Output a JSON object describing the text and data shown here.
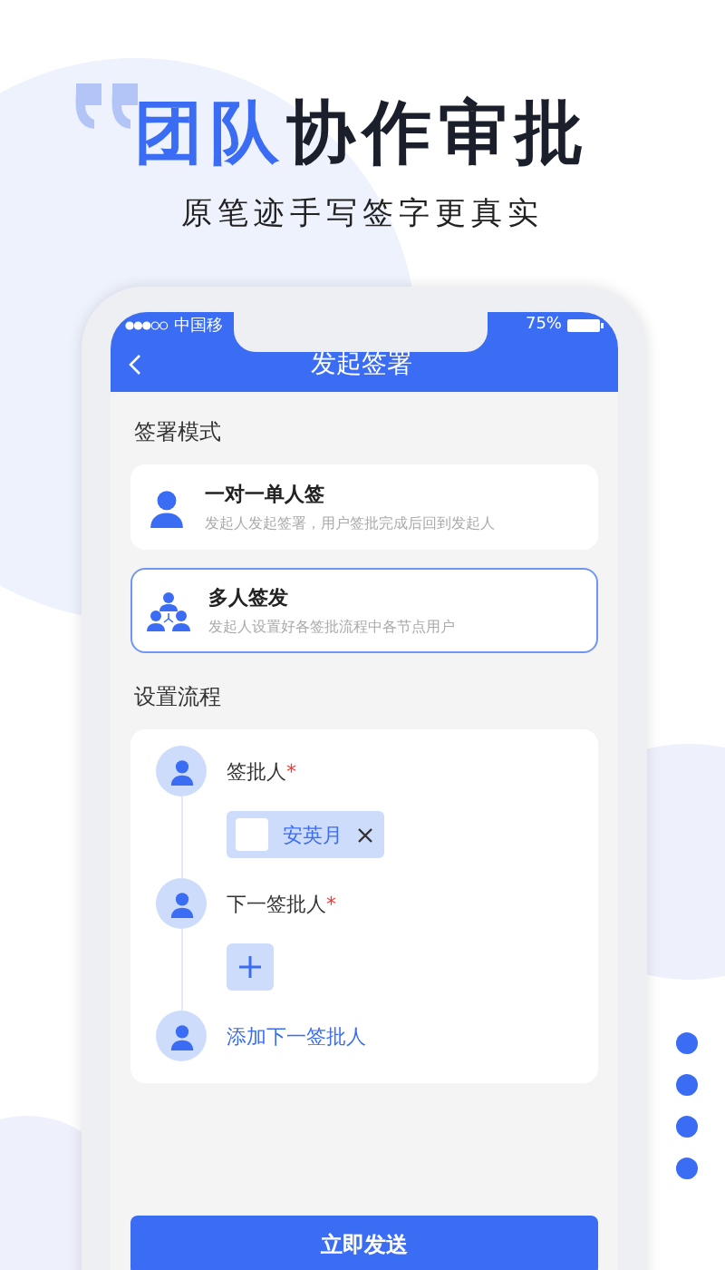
{
  "headline": {
    "accent": "团队",
    "rest": "协作审批"
  },
  "subtitle": "原笔迹手写签字更真实",
  "status_bar": {
    "carrier": "中国移",
    "battery": "75%"
  },
  "nav": {
    "title": "发起签署"
  },
  "mode_section": {
    "label": "签署模式",
    "options": [
      {
        "kind": "single",
        "title": "一对一单人签",
        "description": "发起人发起签署，用户签批完成后回到发起人",
        "selected": false
      },
      {
        "kind": "multi",
        "title": "多人签发",
        "description": "发起人设置好各签批流程中各节点用户",
        "selected": true
      }
    ]
  },
  "flow_section": {
    "label": "设置流程",
    "steps": [
      {
        "kind": "assigned",
        "label": "签批人",
        "required_mark": "*",
        "assignee": "安英月"
      },
      {
        "kind": "empty",
        "label": "下一签批人",
        "required_mark": "*"
      },
      {
        "kind": "add",
        "label": "添加下一签批人"
      }
    ]
  },
  "submit": "立即发送"
}
